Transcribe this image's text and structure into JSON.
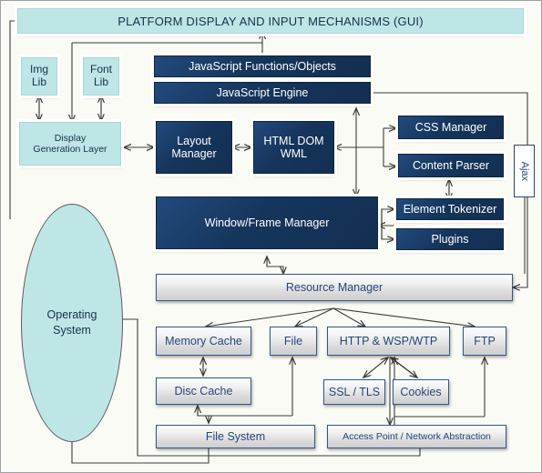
{
  "diagram": {
    "title_bar": {
      "label": "PLATFORM DISPLAY AND INPUT MECHANISMS (GUI)"
    },
    "nodes": {
      "img_lib": "Img\nLib",
      "font_lib": "Font\nLib",
      "display_generation_layer": "Display\nGeneration Layer",
      "js_functions": "JavaScript Functions/Objects",
      "js_engine": "JavaScript Engine",
      "layout_manager": "Layout\nManager",
      "html_dom_wml": "HTML DOM\nWML",
      "css_manager": "CSS Manager",
      "content_parser": "Content Parser",
      "ajax": "Ajax",
      "window_frame_manager": "Window/Frame Manager",
      "element_tokenizer": "Element Tokenizer",
      "plugins": "Plugins",
      "resource_manager": "Resource Manager",
      "operating_system": "Operating\nSystem",
      "memory_cache": "Memory Cache",
      "file": "File",
      "http_wsp_wtp": "HTTP & WSP/WTP",
      "ftp": "FTP",
      "disc_cache": "Disc Cache",
      "ssl_tls": "SSL / TLS",
      "cookies": "Cookies",
      "file_system": "File System",
      "access_point": "Access Point / Network Abstraction"
    },
    "colors": {
      "navy": "#1b3a64",
      "cyan": "#bfe6e6",
      "gray_box_text": "#26457a",
      "background": "#fbfbf5",
      "arrow": "#3b3b3b",
      "border": "#9aa0a6"
    }
  }
}
